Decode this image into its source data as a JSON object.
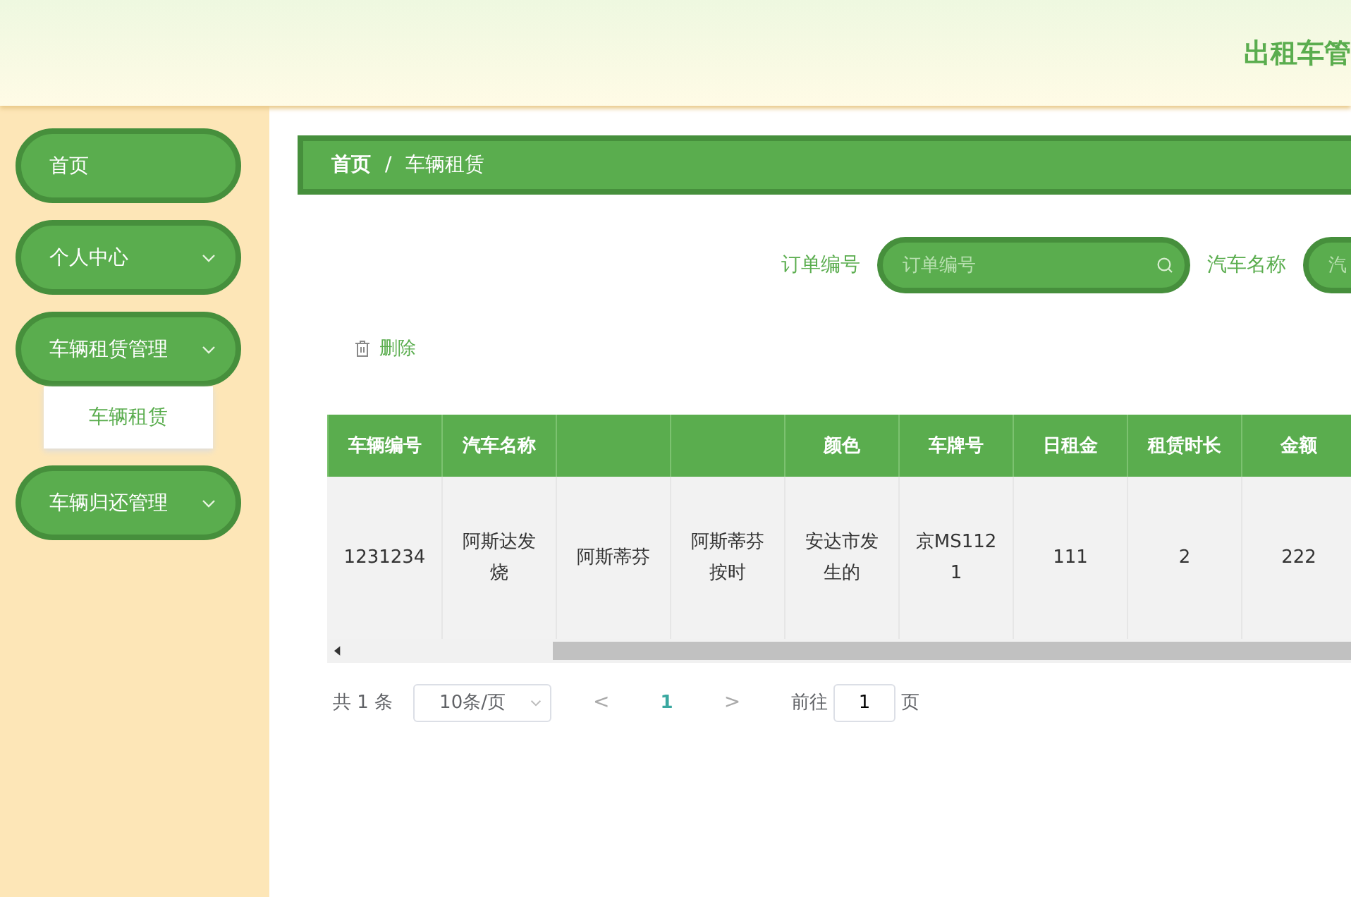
{
  "header": {
    "title": "出租车管"
  },
  "sidebar": {
    "items": [
      {
        "label": "首页",
        "kind": "link"
      },
      {
        "label": "个人中心",
        "kind": "submenu"
      },
      {
        "label": "车辆租赁管理",
        "kind": "submenu",
        "children": [
          {
            "label": "车辆租赁"
          }
        ]
      },
      {
        "label": "车辆归还管理",
        "kind": "submenu"
      }
    ]
  },
  "breadcrumb": {
    "items": [
      "首页",
      "车辆租赁"
    ],
    "separator": "/"
  },
  "search": [
    {
      "label": "订单编号",
      "placeholder": "订单编号"
    },
    {
      "label": "汽车名称",
      "placeholder": "汽"
    }
  ],
  "toolbar": {
    "delete_button": "删除"
  },
  "table": {
    "columns": [
      {
        "label": "车辆编号"
      },
      {
        "label": "汽车名称"
      },
      {},
      {},
      {
        "label": "颜色"
      },
      {
        "label": "车牌号"
      },
      {
        "label": "日租金"
      },
      {
        "label": "租赁时长"
      },
      {
        "label": "金额"
      },
      {}
    ],
    "rows": [
      {
        "cells": [
          "1231234",
          "阿斯达发烧",
          "阿斯蒂芬",
          "阿斯蒂芬按时",
          "安达市发生的",
          "京MS1121",
          "111",
          "2",
          "222"
        ]
      }
    ]
  },
  "pagination": {
    "total": "共 1 条",
    "page_size": "10条/页",
    "prev": "<",
    "pages": [
      {
        "label": "1",
        "selected": true
      }
    ],
    "next": ">",
    "goto_label": "前往",
    "goto_value": "1",
    "goto_suffix": "页"
  }
}
